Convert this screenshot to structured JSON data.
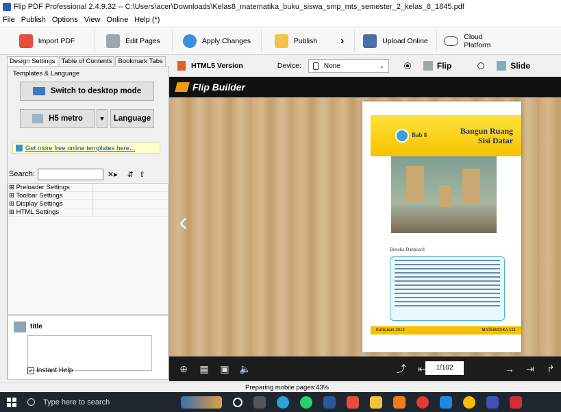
{
  "window": {
    "title": "Flip PDF Professional 2.4.9.32 -- C:\\Users\\acer\\Downloads\\Kelas8_matematika_buku_siswa_smp_mts_semester_2_kelas_8_1845.pdf"
  },
  "menu": [
    "File",
    "Publish",
    "Options",
    "View",
    "Online",
    "Help (*)"
  ],
  "toolbar": {
    "import": "Import PDF",
    "edit": "Edit Pages",
    "apply": "Apply Changes",
    "publish": "Publish",
    "upload": "Upload Online",
    "cloud": "Cloud Platform"
  },
  "left": {
    "tabs": [
      "Design Settings",
      "Table of Contents",
      "Bookmark Tabs"
    ],
    "group": "Templates & Language",
    "switch_desktop": "Switch to desktop mode",
    "template": "H5 metro",
    "language": "Language",
    "more_templates": "Get more free online templates here...",
    "search_label": "Search:",
    "search_value": "",
    "tree": [
      "⊞ Preloader Settings",
      "⊞ Toolbar Settings",
      "⊞ Display Settings",
      "⊞ HTML Settings"
    ],
    "help_title": "title",
    "instant_help": "Instant Help"
  },
  "viewer": {
    "html5": "HTML5 Version",
    "device_label": "Device:",
    "device_value": "None",
    "flip": "Flip",
    "slide": "Slide",
    "brand": "Flip Builder",
    "page_indicator": "1/102",
    "page": {
      "chapter": "Bab 8",
      "title_line1": "Bangun Ruang",
      "title_line2": "Sisi Datar",
      "caption": "Boneka Danboard",
      "footer_left": "Kurikulum 2013",
      "footer_right": "MATEMATIKA",
      "page_num": "121"
    }
  },
  "status": "Preparing mobile pages:43%",
  "taskbar": {
    "search": "Type here to search"
  }
}
